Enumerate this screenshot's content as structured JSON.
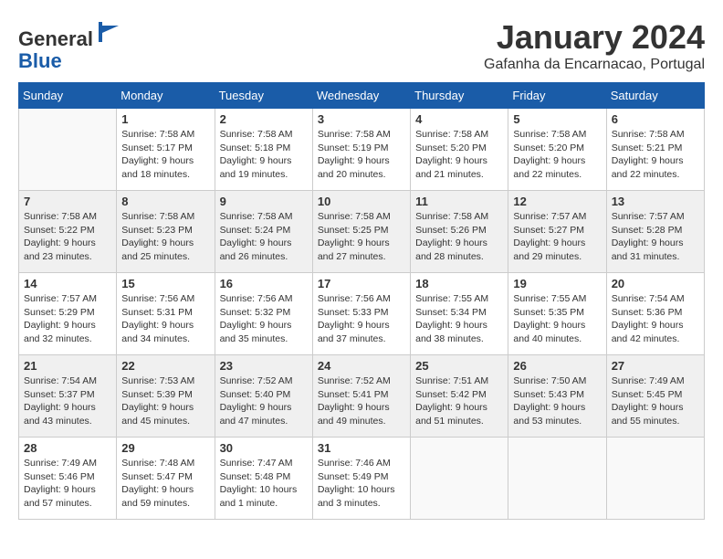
{
  "logo": {
    "general": "General",
    "blue": "Blue"
  },
  "title": "January 2024",
  "subtitle": "Gafanha da Encarnacao, Portugal",
  "days_of_week": [
    "Sunday",
    "Monday",
    "Tuesday",
    "Wednesday",
    "Thursday",
    "Friday",
    "Saturday"
  ],
  "weeks": [
    [
      {
        "day": "",
        "info": ""
      },
      {
        "day": "1",
        "info": "Sunrise: 7:58 AM\nSunset: 5:17 PM\nDaylight: 9 hours\nand 18 minutes."
      },
      {
        "day": "2",
        "info": "Sunrise: 7:58 AM\nSunset: 5:18 PM\nDaylight: 9 hours\nand 19 minutes."
      },
      {
        "day": "3",
        "info": "Sunrise: 7:58 AM\nSunset: 5:19 PM\nDaylight: 9 hours\nand 20 minutes."
      },
      {
        "day": "4",
        "info": "Sunrise: 7:58 AM\nSunset: 5:20 PM\nDaylight: 9 hours\nand 21 minutes."
      },
      {
        "day": "5",
        "info": "Sunrise: 7:58 AM\nSunset: 5:20 PM\nDaylight: 9 hours\nand 22 minutes."
      },
      {
        "day": "6",
        "info": "Sunrise: 7:58 AM\nSunset: 5:21 PM\nDaylight: 9 hours\nand 22 minutes."
      }
    ],
    [
      {
        "day": "7",
        "info": "Sunrise: 7:58 AM\nSunset: 5:22 PM\nDaylight: 9 hours\nand 23 minutes."
      },
      {
        "day": "8",
        "info": "Sunrise: 7:58 AM\nSunset: 5:23 PM\nDaylight: 9 hours\nand 25 minutes."
      },
      {
        "day": "9",
        "info": "Sunrise: 7:58 AM\nSunset: 5:24 PM\nDaylight: 9 hours\nand 26 minutes."
      },
      {
        "day": "10",
        "info": "Sunrise: 7:58 AM\nSunset: 5:25 PM\nDaylight: 9 hours\nand 27 minutes."
      },
      {
        "day": "11",
        "info": "Sunrise: 7:58 AM\nSunset: 5:26 PM\nDaylight: 9 hours\nand 28 minutes."
      },
      {
        "day": "12",
        "info": "Sunrise: 7:57 AM\nSunset: 5:27 PM\nDaylight: 9 hours\nand 29 minutes."
      },
      {
        "day": "13",
        "info": "Sunrise: 7:57 AM\nSunset: 5:28 PM\nDaylight: 9 hours\nand 31 minutes."
      }
    ],
    [
      {
        "day": "14",
        "info": "Sunrise: 7:57 AM\nSunset: 5:29 PM\nDaylight: 9 hours\nand 32 minutes."
      },
      {
        "day": "15",
        "info": "Sunrise: 7:56 AM\nSunset: 5:31 PM\nDaylight: 9 hours\nand 34 minutes."
      },
      {
        "day": "16",
        "info": "Sunrise: 7:56 AM\nSunset: 5:32 PM\nDaylight: 9 hours\nand 35 minutes."
      },
      {
        "day": "17",
        "info": "Sunrise: 7:56 AM\nSunset: 5:33 PM\nDaylight: 9 hours\nand 37 minutes."
      },
      {
        "day": "18",
        "info": "Sunrise: 7:55 AM\nSunset: 5:34 PM\nDaylight: 9 hours\nand 38 minutes."
      },
      {
        "day": "19",
        "info": "Sunrise: 7:55 AM\nSunset: 5:35 PM\nDaylight: 9 hours\nand 40 minutes."
      },
      {
        "day": "20",
        "info": "Sunrise: 7:54 AM\nSunset: 5:36 PM\nDaylight: 9 hours\nand 42 minutes."
      }
    ],
    [
      {
        "day": "21",
        "info": "Sunrise: 7:54 AM\nSunset: 5:37 PM\nDaylight: 9 hours\nand 43 minutes."
      },
      {
        "day": "22",
        "info": "Sunrise: 7:53 AM\nSunset: 5:39 PM\nDaylight: 9 hours\nand 45 minutes."
      },
      {
        "day": "23",
        "info": "Sunrise: 7:52 AM\nSunset: 5:40 PM\nDaylight: 9 hours\nand 47 minutes."
      },
      {
        "day": "24",
        "info": "Sunrise: 7:52 AM\nSunset: 5:41 PM\nDaylight: 9 hours\nand 49 minutes."
      },
      {
        "day": "25",
        "info": "Sunrise: 7:51 AM\nSunset: 5:42 PM\nDaylight: 9 hours\nand 51 minutes."
      },
      {
        "day": "26",
        "info": "Sunrise: 7:50 AM\nSunset: 5:43 PM\nDaylight: 9 hours\nand 53 minutes."
      },
      {
        "day": "27",
        "info": "Sunrise: 7:49 AM\nSunset: 5:45 PM\nDaylight: 9 hours\nand 55 minutes."
      }
    ],
    [
      {
        "day": "28",
        "info": "Sunrise: 7:49 AM\nSunset: 5:46 PM\nDaylight: 9 hours\nand 57 minutes."
      },
      {
        "day": "29",
        "info": "Sunrise: 7:48 AM\nSunset: 5:47 PM\nDaylight: 9 hours\nand 59 minutes."
      },
      {
        "day": "30",
        "info": "Sunrise: 7:47 AM\nSunset: 5:48 PM\nDaylight: 10 hours\nand 1 minute."
      },
      {
        "day": "31",
        "info": "Sunrise: 7:46 AM\nSunset: 5:49 PM\nDaylight: 10 hours\nand 3 minutes."
      },
      {
        "day": "",
        "info": ""
      },
      {
        "day": "",
        "info": ""
      },
      {
        "day": "",
        "info": ""
      }
    ]
  ]
}
